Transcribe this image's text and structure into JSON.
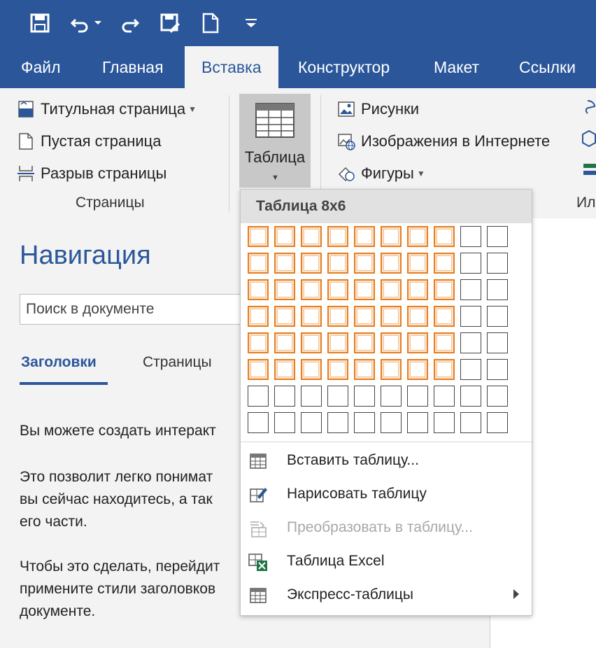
{
  "tabs": [
    "Файл",
    "Главная",
    "Вставка",
    "Конструктор",
    "Макет",
    "Ссылки"
  ],
  "active_tab": "Вставка",
  "quick_access": [
    "save-icon",
    "undo-icon",
    "redo-icon",
    "save-as-icon",
    "new-document-icon",
    "customize-icon"
  ],
  "ribbon": {
    "pages_group": {
      "cover_page": "Титульная страница",
      "blank_page": "Пустая страница",
      "page_break": "Разрыв страницы",
      "label": "Страницы"
    },
    "table_button": "Таблица",
    "illustrations": {
      "pictures": "Рисунки",
      "online_pictures": "Изображения в Интернете",
      "shapes": "Фигуры",
      "label_partial": "Ил"
    }
  },
  "dropdown": {
    "header": "Таблица 8x6",
    "grid": {
      "columns": 10,
      "rows": 8,
      "selected_columns": 8,
      "selected_rows": 6
    },
    "items": [
      {
        "label": "Вставить таблицу...",
        "icon": "insert-table-icon",
        "disabled": false,
        "submenu": false
      },
      {
        "label": "Нарисовать таблицу",
        "icon": "draw-table-icon",
        "disabled": false,
        "submenu": false
      },
      {
        "label": "Преобразовать в таблицу...",
        "icon": "convert-table-icon",
        "disabled": true,
        "submenu": false
      },
      {
        "label": "Таблица Excel",
        "icon": "excel-table-icon",
        "disabled": false,
        "submenu": false
      },
      {
        "label": "Экспресс-таблицы",
        "icon": "quick-tables-icon",
        "disabled": false,
        "submenu": true
      }
    ]
  },
  "navigation": {
    "title": "Навигация",
    "search_placeholder": "Поиск в документе",
    "tab_headings": "Заголовки",
    "tab_pages": "Страницы",
    "text_lines": [
      "Вы можете создать интеракт",
      "Это позволит легко понимат",
      "вы сейчас находитесь, а так",
      "его части.",
      "Чтобы это сделать, перейдит",
      "примените стили заголовков",
      "документе."
    ]
  },
  "colors": {
    "accent": "#2b579a",
    "selection": "#e67e22",
    "ribbon_bg": "#f3f3f3"
  }
}
